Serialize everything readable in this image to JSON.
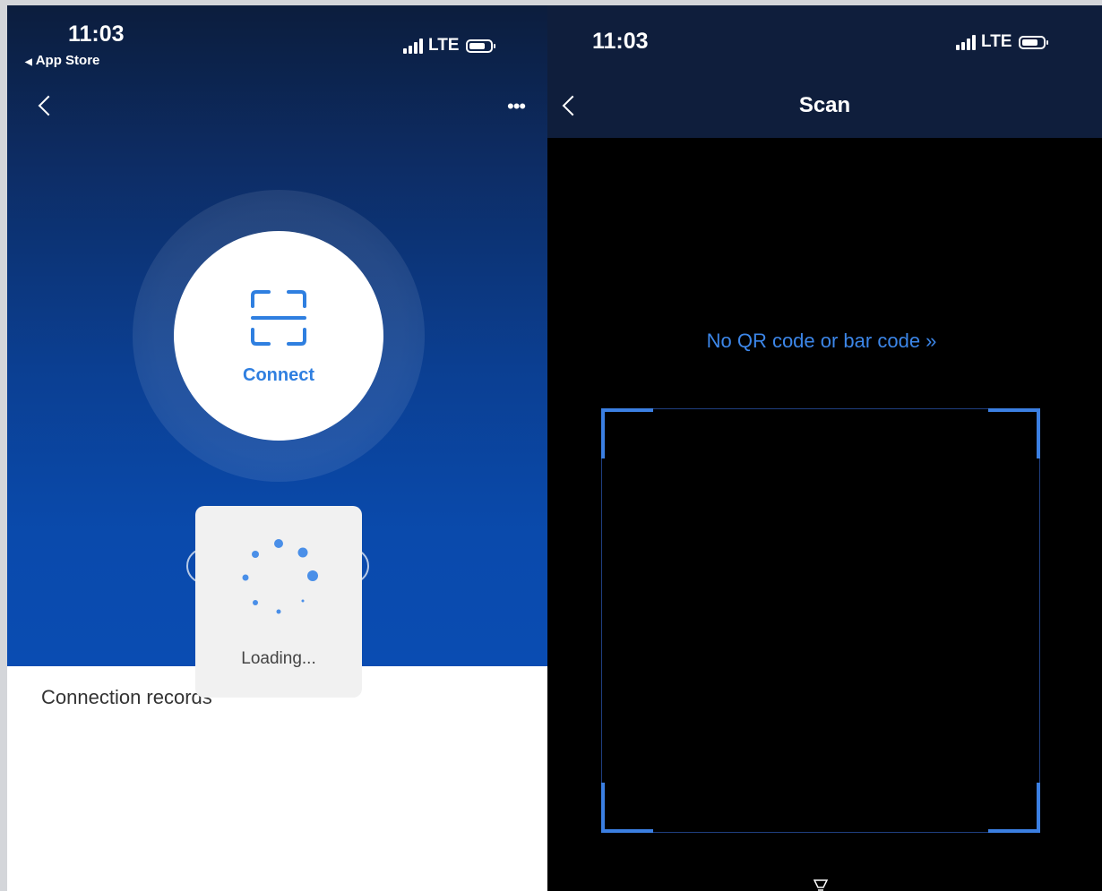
{
  "left_screen": {
    "status_bar": {
      "time": "11:03",
      "back_app": "App Store",
      "network": "LTE"
    },
    "connect_button": {
      "label": "Connect",
      "icon": "scan-frame-icon"
    },
    "loading": {
      "text": "Loading..."
    },
    "records": {
      "label": "Connection records"
    },
    "nav": {
      "back_icon": "chevron-left-icon",
      "more_icon": "ellipsis-icon"
    }
  },
  "right_screen": {
    "status_bar": {
      "time": "11:03",
      "network": "LTE"
    },
    "header": {
      "title": "Scan"
    },
    "no_code_link": "No QR code or bar code »",
    "nav": {
      "back_icon": "chevron-left-icon"
    },
    "flash_icon": "flashlight-icon"
  },
  "colors": {
    "accent": "#2f7fe0",
    "link": "#3c86e8",
    "scan_corner": "#3b7fe2",
    "header_dark": "#0f1e3c",
    "hero_blue": "#0a4cb2"
  }
}
